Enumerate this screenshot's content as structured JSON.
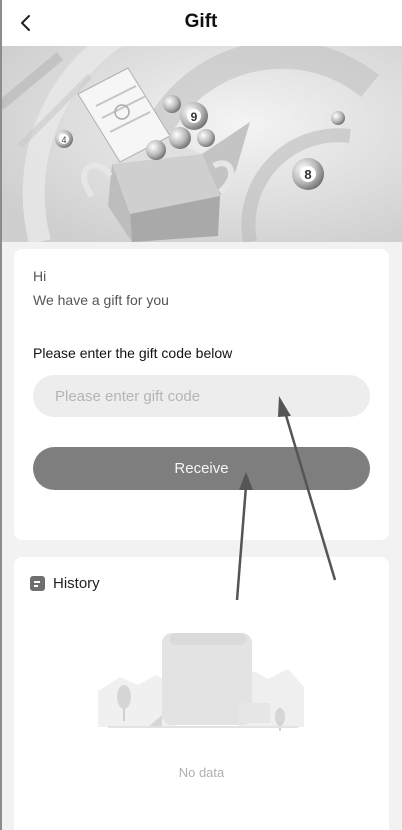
{
  "header": {
    "title": "Gift",
    "back_icon": "chevron-left-icon"
  },
  "banner": {
    "ball_numbers": [
      "4",
      "9",
      "8"
    ],
    "image_name": "gift-box-illustration"
  },
  "gift": {
    "greeting": "Hi",
    "subtitle": "We have a gift for you",
    "prompt": "Please enter the gift code below",
    "input_placeholder": "Please enter gift code",
    "input_value": "",
    "button_label": "Receive"
  },
  "history": {
    "title": "History",
    "icon": "calendar-icon",
    "empty_text": "No data",
    "empty_icon": "empty-scroll-icon"
  },
  "colors": {
    "button": "#7e7e7e",
    "input_bg": "#ededed",
    "page_bg": "#f2f2f2",
    "arrow": "#555555"
  }
}
